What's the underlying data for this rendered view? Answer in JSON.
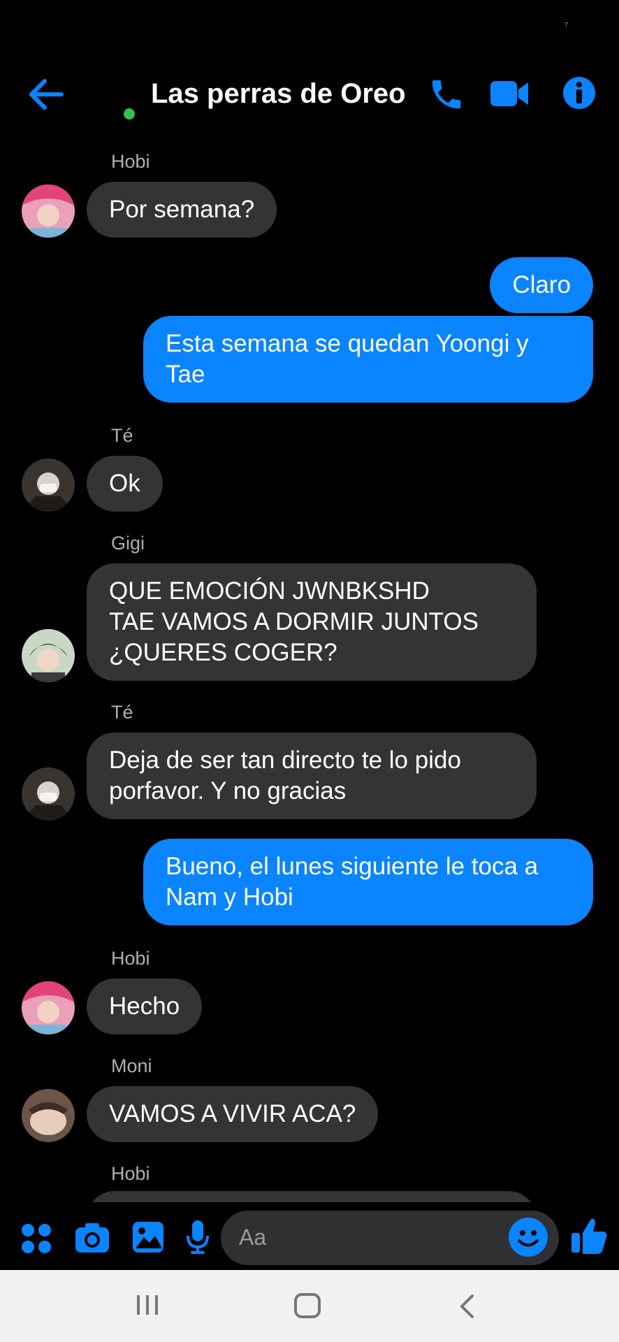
{
  "header": {
    "title": "Las perras de Oreo"
  },
  "messages": [
    {
      "sender": "Hobi",
      "text": [
        "Por semana?"
      ],
      "dir": "in"
    },
    {
      "text": [
        "Claro"
      ],
      "dir": "out"
    },
    {
      "text": [
        "Esta semana se quedan Yoongi y",
        "Tae"
      ],
      "dir": "out"
    },
    {
      "sender": "Té",
      "text": [
        "Ok"
      ],
      "dir": "in"
    },
    {
      "sender": "Gigi",
      "text": [
        "QUE EMOCIÓN JWNBKSHD",
        "TAE VAMOS A DORMIR JUNTOS",
        "¿QUERES COGER?"
      ],
      "dir": "in"
    },
    {
      "sender": "Té",
      "text": [
        "Deja de ser tan directo te lo pido",
        "porfavor. Y no gracias"
      ],
      "dir": "in"
    },
    {
      "text": [
        "Bueno, el lunes siguiente le toca a",
        "Nam y Hobi"
      ],
      "dir": "out"
    },
    {
      "sender": "Hobi",
      "text": [
        "Hecho"
      ],
      "dir": "in"
    },
    {
      "sender": "Moni",
      "text": [
        "VAMOS A VIVIR ACA?"
      ],
      "dir": "in"
    },
    {
      "sender": "Hobi"
    }
  ],
  "composer": {
    "placeholder": "Aa"
  },
  "colors": {
    "accent": "#0a84ff",
    "incoming": "#333436",
    "online": "#31c24b"
  }
}
